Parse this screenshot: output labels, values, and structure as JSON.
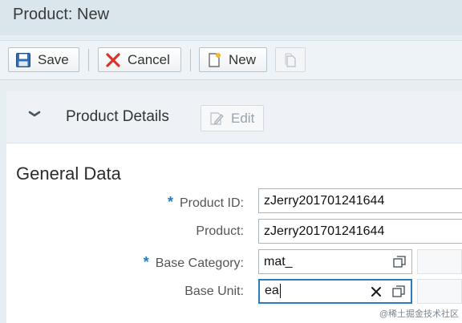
{
  "header": {
    "title": "Product: New"
  },
  "toolbar": {
    "save_label": "Save",
    "cancel_label": "Cancel",
    "new_label": "New",
    "copy_icon": "copy-icon"
  },
  "section": {
    "title": "Product Details",
    "edit_label": "Edit"
  },
  "group": {
    "title": "General Data",
    "fields": [
      {
        "label": "Product ID:",
        "value": "zJerry201701241644",
        "required": true
      },
      {
        "label": "Product:",
        "value": "zJerry201701241644",
        "required": false
      },
      {
        "label": "Base Category:",
        "value": "mat_",
        "required": true
      },
      {
        "label": "Base Unit:",
        "value": "ea",
        "required": false
      }
    ],
    "required_mark": "*"
  },
  "watermark": "@稀土掘金技术社区",
  "colors": {
    "accent": "#2b7cbf",
    "cancel": "#d9342b",
    "required": "#1d7ec3"
  }
}
